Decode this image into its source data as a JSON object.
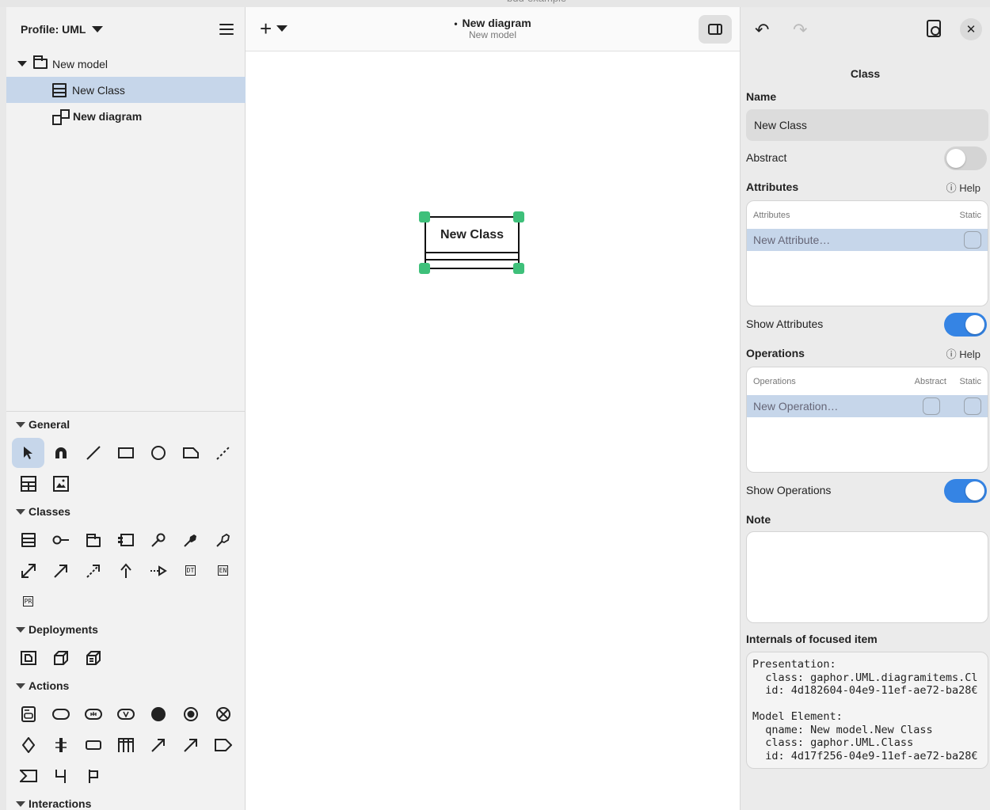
{
  "window": {
    "title_partial": "bdd-example"
  },
  "left_header": {
    "profile_label": "Profile: UML"
  },
  "tree": {
    "items": [
      {
        "label": "New model",
        "kind": "package"
      },
      {
        "label": "New Class",
        "kind": "class"
      },
      {
        "label": "New diagram",
        "kind": "diagram"
      }
    ]
  },
  "toolbox": {
    "sections": {
      "general": "General",
      "classes": "Classes",
      "deployments": "Deployments",
      "actions": "Actions",
      "interactions": "Interactions"
    },
    "mini_labels": {
      "dt": "DT",
      "en": "EN",
      "pr": "PR"
    }
  },
  "center_header": {
    "add_label": "+",
    "diagram_title": "New diagram",
    "diagram_subtitle": "New model",
    "unsaved_dot": "•"
  },
  "canvas": {
    "class_name": "New Class"
  },
  "right_header": {
    "undo": "↶",
    "redo": "↷",
    "close": "✕"
  },
  "properties": {
    "title": "Class",
    "name_label": "Name",
    "name_value": "New Class",
    "abstract_label": "Abstract",
    "abstract_on": false,
    "attributes_label": "Attributes",
    "help_label": "ⓘ Help",
    "attributes_table": {
      "col_name": "Attributes",
      "col_static": "Static",
      "new_row": "New Attribute…"
    },
    "show_attributes_label": "Show Attributes",
    "show_attributes_on": true,
    "operations_label": "Operations",
    "operations_table": {
      "col_name": "Operations",
      "col_abstract": "Abstract",
      "col_static": "Static",
      "new_row": "New Operation…"
    },
    "show_operations_label": "Show Operations",
    "show_operations_on": true,
    "note_label": "Note",
    "internals_label": "Internals of focused item",
    "internals_text": "Presentation:\n  class: gaphor.UML.diagramitems.Cl\n  id: 4d182604-04e9-11ef-ae72-ba28€\n\nModel Element:\n  qname: New model.New Class\n  class: gaphor.UML.Class\n  id: 4d17f256-04e9-11ef-ae72-ba28€"
  },
  "colors": {
    "accent": "#3584e4",
    "selection": "#c6d6ea",
    "handle": "#3ec07a"
  }
}
